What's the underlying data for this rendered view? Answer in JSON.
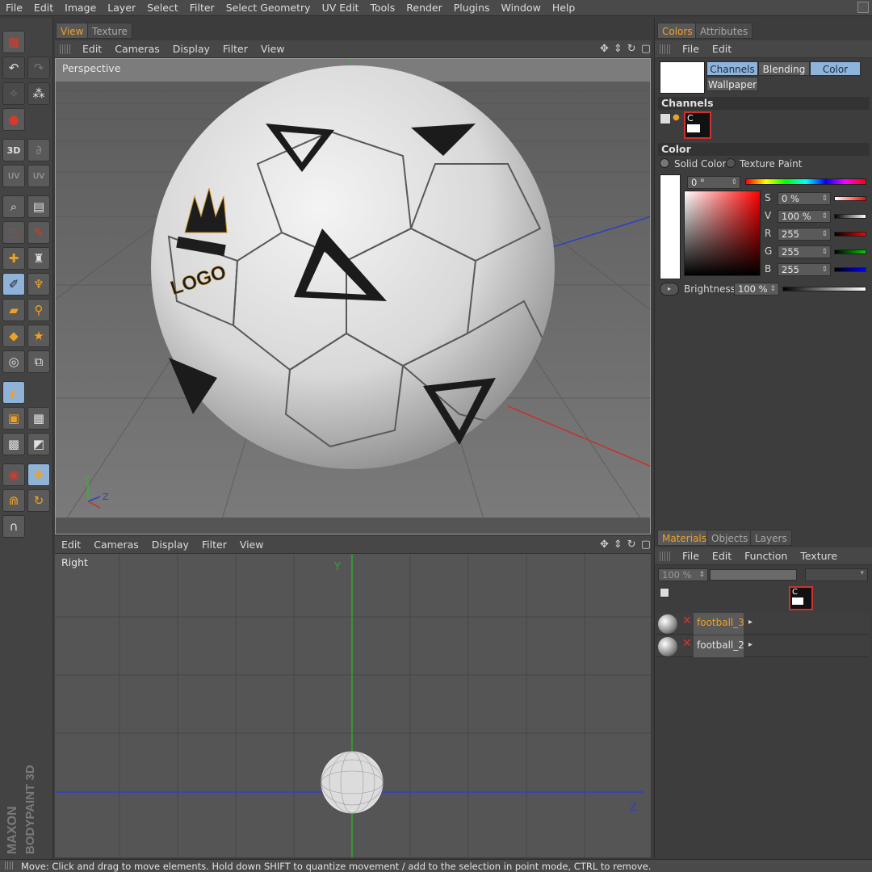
{
  "menubar": [
    "File",
    "Edit",
    "Image",
    "Layer",
    "Select",
    "Filter",
    "Select Geometry",
    "UV Edit",
    "Tools",
    "Render",
    "Plugins",
    "Window",
    "Help"
  ],
  "left_tabs": {
    "view": "View",
    "texture": "Texture"
  },
  "viewport_menu": [
    "Edit",
    "Cameras",
    "Display",
    "Filter",
    "View"
  ],
  "viewport_top": {
    "label": "Perspective",
    "logo_text": "LOGO",
    "axis_y": "Y",
    "axis_z": "Z"
  },
  "viewport_bottom": {
    "label": "Right",
    "axis_y": "Y",
    "axis_z": "Z"
  },
  "right_top_tabs": {
    "colors": "Colors",
    "attributes": "Attributes"
  },
  "colors_menu": [
    "File",
    "Edit"
  ],
  "colors_buttons": {
    "channels": "Channels",
    "blending": "Blending",
    "color": "Color",
    "wallpaper": "Wallpaper"
  },
  "channels_title": "Channels",
  "channels_swatch_label": "C",
  "color_title": "Color",
  "color_mode": {
    "solid": "Solid Color",
    "paint": "Texture Paint"
  },
  "hue": "0 °",
  "sliders": [
    {
      "label": "S",
      "value": "0 %"
    },
    {
      "label": "V",
      "value": "100 %"
    },
    {
      "label": "R",
      "value": "255"
    },
    {
      "label": "G",
      "value": "255"
    },
    {
      "label": "B",
      "value": "255"
    }
  ],
  "brightness": {
    "label": "Brightness",
    "value": "100 %"
  },
  "materials_tabs": {
    "materials": "Materials",
    "objects": "Objects",
    "layers": "Layers"
  },
  "materials_menu": [
    "File",
    "Edit",
    "Function",
    "Texture"
  ],
  "materials_zoom": "100 %",
  "materials": [
    {
      "name": "football_3",
      "active": true
    },
    {
      "name": "football_2",
      "active": false
    }
  ],
  "brand": {
    "line1": "MAXON",
    "line2": "BODYPAINT 3D"
  },
  "status": "Move: Click and drag to move elements. Hold down SHIFT to quantize movement / add to the selection in point mode, CTRL to remove.",
  "toolbar_icons": [
    "layer-icon",
    "undo-icon",
    "redo-icon",
    "magic-wand-icon",
    "sphere-icon",
    "3d-paint-icon",
    "projection-icon",
    "uv-icon",
    "uv-edit-icon",
    "magnifier-icon",
    "paint-setup-icon",
    "rect-select-icon",
    "lasso-icon",
    "move-tool-icon",
    "clone-icon",
    "brush-icon",
    "smudge-icon",
    "eraser-icon",
    "eyedropper-icon",
    "fill-icon",
    "star-icon",
    "stamp-icon",
    "transform-icon",
    "snap-icon",
    "texture-grid-icon",
    "checker-icon",
    "uv-grid-icon",
    "mask-icon",
    "live-select-icon",
    "move-icon",
    "magnet-icon",
    "rotate-icon",
    "magnet-snap-icon"
  ]
}
